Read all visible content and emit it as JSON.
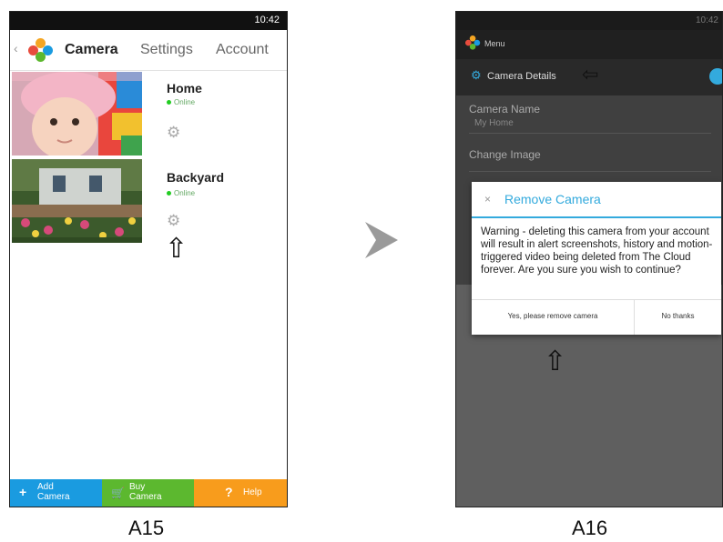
{
  "screens": [
    {
      "caption": "A15",
      "status_time": "10:42",
      "tabs": {
        "camera": "Camera",
        "settings": "Settings",
        "account": "Account"
      },
      "cameras": [
        {
          "name": "Home",
          "status": "Online"
        },
        {
          "name": "Backyard",
          "status": "Online"
        }
      ],
      "bottom_bar": [
        {
          "icon": "+",
          "label_line1": "Add",
          "label_line2": "Camera",
          "color": "#1a9be0"
        },
        {
          "icon": "cart",
          "label_line1": "Buy",
          "label_line2": "Camera",
          "color": "#5cb82f"
        },
        {
          "icon": "?",
          "label": "Help",
          "color": "#f89c1c"
        }
      ]
    },
    {
      "caption": "A16",
      "status_time": "10:42",
      "menu_label": "Menu",
      "section_title": "Camera Details",
      "fields": [
        {
          "label": "Camera Name",
          "value": "My Home"
        },
        {
          "label": "Change Image"
        }
      ],
      "dialog": {
        "title": "Remove Camera",
        "message": "Warning - deleting this camera from your account will result in alert screenshots, history and motion-triggered video being deleted from The Cloud forever. Are you sure you wish to continue?",
        "confirm_button": "Yes, please remove camera",
        "cancel_button": "No thanks"
      }
    }
  ],
  "colors": {
    "accent": "#33aadd",
    "online": "#22cc22"
  }
}
